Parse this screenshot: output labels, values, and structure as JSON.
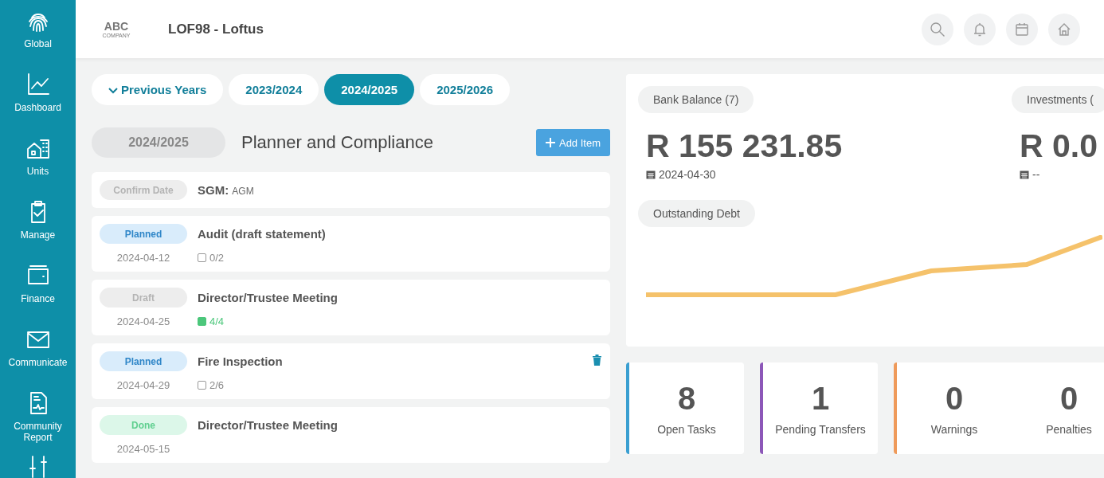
{
  "sidebar": {
    "items": [
      {
        "label": "Global",
        "kind": "fingerprint",
        "selected": false
      },
      {
        "label": "Dashboard",
        "kind": "chart",
        "selected": false
      },
      {
        "label": "Units",
        "kind": "buildings",
        "selected": false
      },
      {
        "label": "Manage",
        "kind": "clipboard",
        "selected": false
      },
      {
        "label": "Finance",
        "kind": "wallet",
        "selected": false
      },
      {
        "label": "Communicate",
        "kind": "mail",
        "selected": false
      },
      {
        "label": "Community Report",
        "kind": "report",
        "selected": false
      },
      {
        "kind": "sliders",
        "selected": false
      }
    ]
  },
  "header": {
    "logo": "ABC",
    "logo_sub": "COMPANY",
    "title": "LOF98 - Loftus"
  },
  "year_tabs": [
    {
      "label": "Previous Years",
      "kind": "dropdown",
      "selected": false
    },
    {
      "label": "2023/2024",
      "kind": "year",
      "selected": false
    },
    {
      "label": "2024/2025",
      "kind": "year",
      "selected": true
    },
    {
      "label": "2025/2026",
      "kind": "year",
      "selected": false
    }
  ],
  "planner": {
    "year": "2024/2025",
    "title": "Planner and Compliance",
    "add_button": "Add Item",
    "items": [
      {
        "status": "Confirm Date",
        "kind": "confirm",
        "title": "SGM:",
        "subtitle": "AGM"
      },
      {
        "status": "Planned",
        "kind": "planned",
        "title": "Audit (draft statement)",
        "date": "2024-04-12",
        "tasks": "0/2",
        "complete": false,
        "delete": false
      },
      {
        "status": "Draft",
        "kind": "draft",
        "title": "Director/Trustee Meeting",
        "date": "2024-04-25",
        "tasks": "4/4",
        "complete": true,
        "delete": false
      },
      {
        "status": "Planned",
        "kind": "planned",
        "title": "Fire Inspection",
        "date": "2024-04-29",
        "tasks": "2/6",
        "complete": false,
        "delete": true
      },
      {
        "status": "Done",
        "kind": "done",
        "title": "Director/Trustee Meeting",
        "date": "2024-05-15",
        "delete": false
      }
    ]
  },
  "balances": [
    {
      "label": "Bank Balance (7)",
      "amount": "R 155 231.85",
      "date": "2024-04-30"
    },
    {
      "label": "Investments (",
      "amount": "R 0.0",
      "date": "--"
    }
  ],
  "debt": {
    "label": "Outstanding Debt"
  },
  "stats": [
    {
      "value": "8",
      "label": "Open Tasks",
      "color": "#3a9fd1"
    },
    {
      "value": "1",
      "label": "Pending Transfers",
      "color": "#8c57b8"
    },
    {
      "value": "0",
      "label": "Warnings",
      "color": "#ef9a5a",
      "extra_value": "0",
      "extra_label": "Penalties"
    }
  ]
}
